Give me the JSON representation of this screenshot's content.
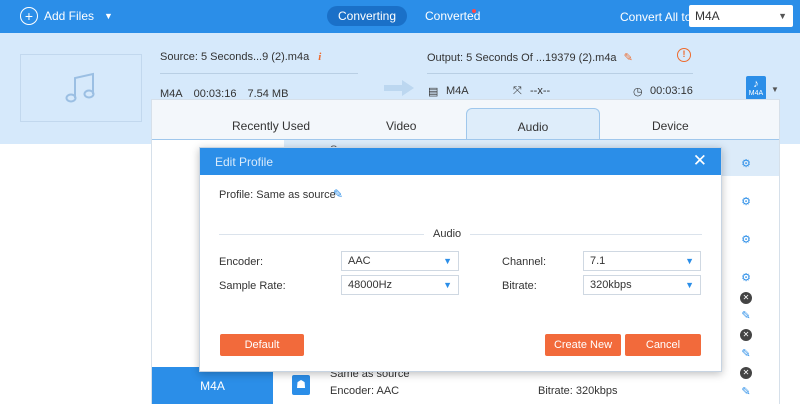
{
  "topbar": {
    "add_files_label": "Add Files",
    "tabs": [
      {
        "label": "Converting"
      },
      {
        "label": "Converted"
      }
    ],
    "convert_all_label": "Convert All to:",
    "convert_all_value": "M4A"
  },
  "file": {
    "source_name": "Source: 5 Seconds...9 (2).m4a",
    "source_format": "M4A",
    "source_duration": "00:03:16",
    "source_size": "7.54 MB",
    "output_name": "Output: 5 Seconds Of ...19379 (2).m4a",
    "output_format": "M4A",
    "output_resolution": "--x--",
    "output_duration": "00:03:16",
    "badge_label": "M4A"
  },
  "format_panel": {
    "tabs": [
      {
        "label": "Recently Used"
      },
      {
        "label": "Video"
      },
      {
        "label": "Audio"
      },
      {
        "label": "Device"
      }
    ],
    "active_tab": "Audio",
    "selected_format": "M4A",
    "top_item_partial": "Same as source",
    "list_item": {
      "title": "Same as source",
      "encoder": "Encoder: AAC",
      "bitrate": "Bitrate: 320kbps"
    }
  },
  "dialog": {
    "title": "Edit Profile",
    "profile_label": "Profile: Same as source",
    "section": "Audio",
    "encoder_label": "Encoder:",
    "encoder_value": "AAC",
    "channel_label": "Channel:",
    "channel_value": "7.1",
    "sample_rate_label": "Sample Rate:",
    "sample_rate_value": "48000Hz",
    "bitrate_label": "Bitrate:",
    "bitrate_value": "320kbps",
    "default_button": "Default",
    "create_new_button": "Create New",
    "cancel_button": "Cancel"
  },
  "colors": {
    "accent": "#2b8ee8",
    "button": "#f26a3b",
    "warning": "#ee6a2c"
  }
}
